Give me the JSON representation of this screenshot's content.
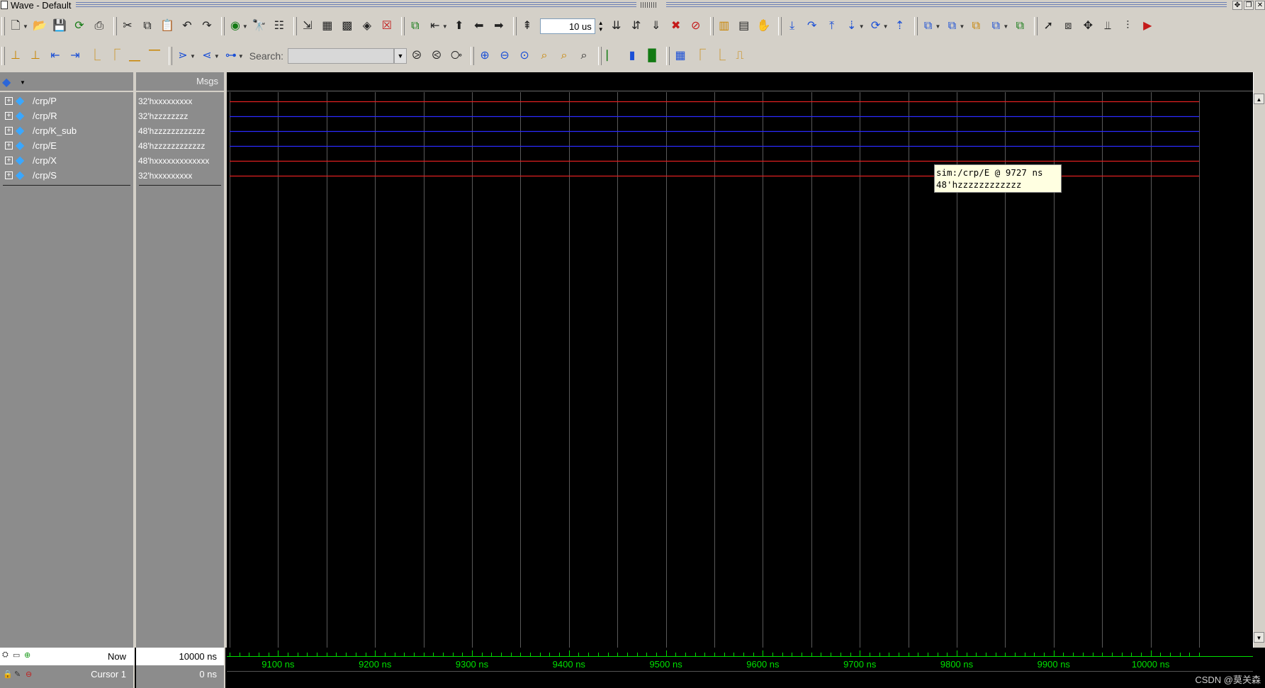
{
  "window": {
    "title": "Wave - Default"
  },
  "toolbar": {
    "run_length": "10 us",
    "search_label": "Search:",
    "search_value": ""
  },
  "headers": {
    "msgs": "Msgs"
  },
  "signals": [
    {
      "name": "/crp/P",
      "value": "32'hxxxxxxxxx",
      "color": "#e02020"
    },
    {
      "name": "/crp/R",
      "value": "32'hzzzzzzzz",
      "color": "#2b2bff"
    },
    {
      "name": "/crp/K_sub",
      "value": "48'hzzzzzzzzzzzz",
      "color": "#2b2bff"
    },
    {
      "name": "/crp/E",
      "value": "48'hzzzzzzzzzzzz",
      "color": "#2b2bff"
    },
    {
      "name": "/crp/X",
      "value": "48'hxxxxxxxxxxxxx",
      "color": "#e02020"
    },
    {
      "name": "/crp/S",
      "value": "32'hxxxxxxxxx",
      "color": "#e02020"
    }
  ],
  "tooltip": {
    "line1": "sim:/crp/E @ 9727 ns",
    "line2": "48'hzzzzzzzzzzzz"
  },
  "status": {
    "now_label": "Now",
    "now_value": "10000 ns",
    "cursor_label": "Cursor 1",
    "cursor_value": "0 ns"
  },
  "timeline": {
    "unit": "ns",
    "ticks": [
      "9100 ns",
      "9200 ns",
      "9300 ns",
      "9400 ns",
      "9500 ns",
      "9600 ns",
      "9700 ns",
      "9800 ns",
      "9900 ns",
      "10000 ns"
    ],
    "tick_values": [
      9100,
      9200,
      9300,
      9400,
      9500,
      9600,
      9700,
      9800,
      9900,
      10000
    ],
    "range": [
      9050,
      10050
    ],
    "grid_step_ns": 50,
    "axis_color": "#00e000"
  },
  "watermark": "CSDN @莫关森"
}
